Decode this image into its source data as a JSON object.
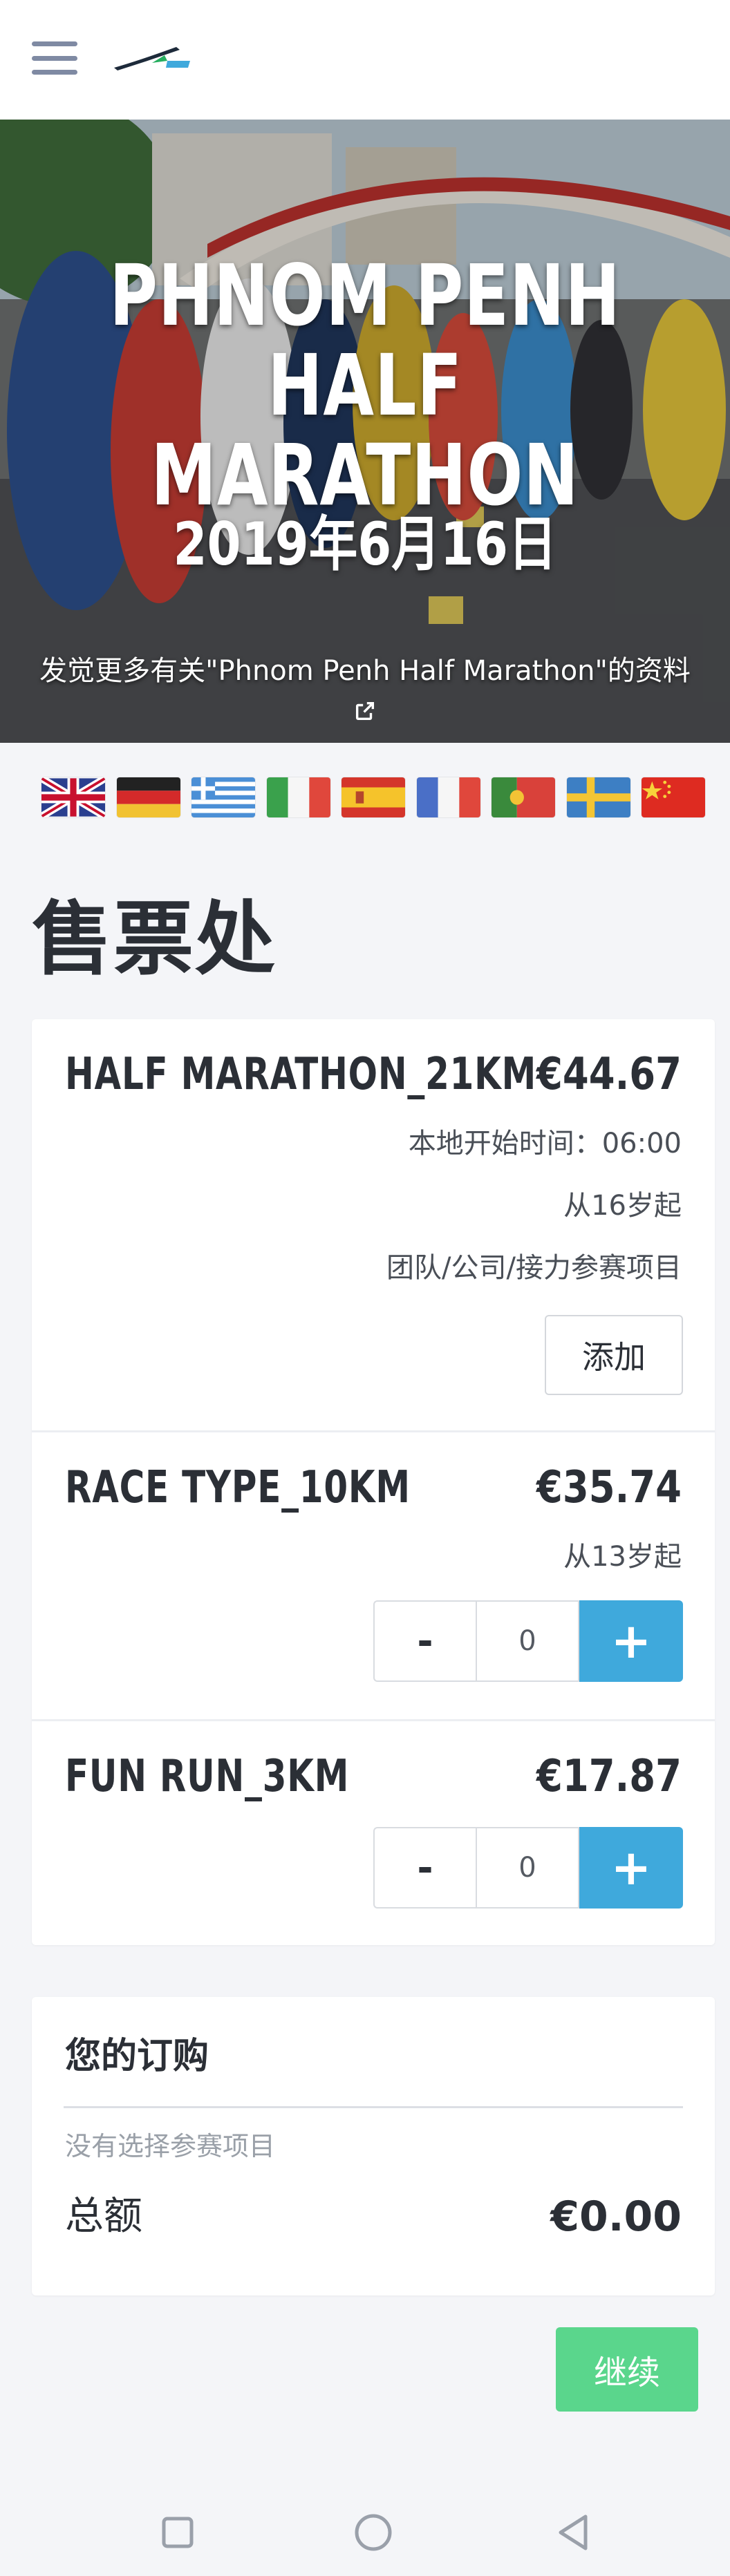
{
  "hero": {
    "title_line1": "PHNOM PENH",
    "title_line2": "HALF MARATHON",
    "date": "2019年6月16日",
    "link_text": "发觉更多有关\"Phnom Penh Half Marathon\"的资料"
  },
  "flags": [
    "uk-flag",
    "german-flag",
    "greek-flag",
    "italian-flag",
    "spanish-flag",
    "french-flag",
    "portuguese-flag",
    "swedish-flag",
    "chinese-flag"
  ],
  "section_title": "售票处",
  "tickets": [
    {
      "name": "HALF MARATHON_21KM",
      "price": "€44.67",
      "start_time": "本地开始时间：06:00",
      "age": "从16岁起",
      "team_note": "团队/公司/接力参赛项目",
      "add_label": "添加"
    },
    {
      "name": "RACE TYPE_10KM",
      "price": "€35.74",
      "age": "从13岁起",
      "minus": "-",
      "qty": "0",
      "plus": "+"
    },
    {
      "name": "FUN RUN_3KM",
      "price": "€17.87",
      "minus": "-",
      "qty": "0",
      "plus": "+"
    }
  ],
  "order": {
    "title": "您的订购",
    "empty_text": "没有选择参赛项目",
    "total_label": "总额",
    "total_value": "€0.00"
  },
  "continue_label": "继续",
  "colors": {
    "accent_blue": "#3fa9dc",
    "continue_green": "#5ad68c",
    "page_bg": "#f4f5f8",
    "text": "#2b2f36"
  }
}
